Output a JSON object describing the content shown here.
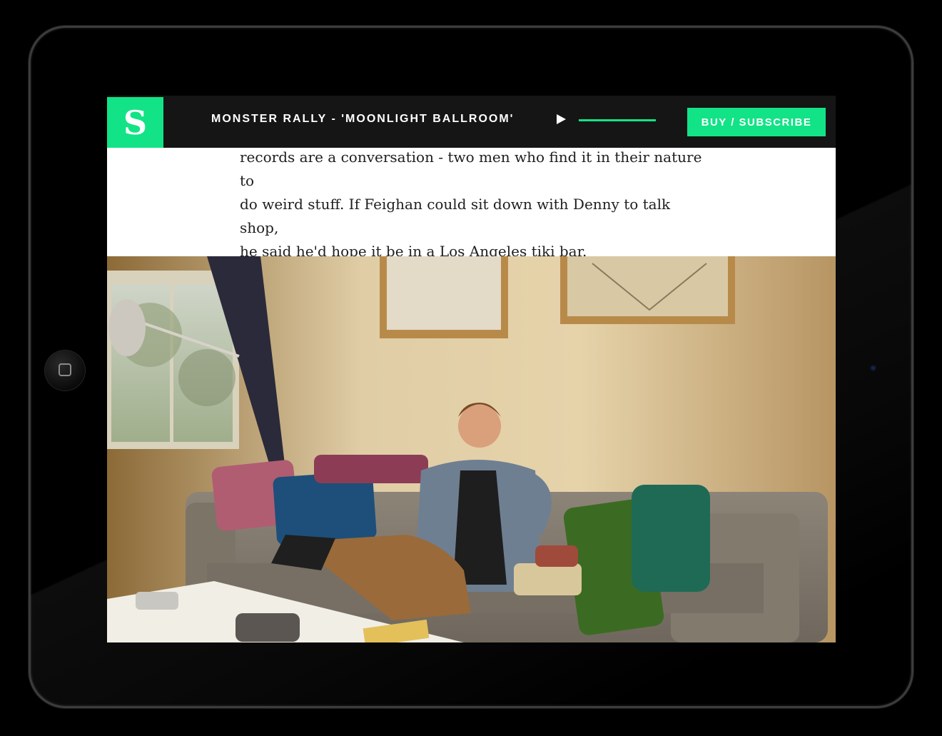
{
  "header": {
    "logo_letter": "S",
    "track_title": "MONSTER RALLY - 'MOONLIGHT BALLROOM'",
    "buy_label": "BUY / SUBSCRIBE",
    "progress": 1.0
  },
  "article": {
    "lines": [
      "records are a conversation - two men who find it in their nature to",
      "do weird stuff. If Feighan could sit down with Denny to talk shop,",
      "he said he'd hope it be in a Los Angeles tiki bar."
    ]
  },
  "icons": {
    "play": "play-icon",
    "home": "home-button-icon",
    "camera": "camera-icon"
  },
  "colors": {
    "accent": "#12e386",
    "header_bg": "#151515",
    "text": "#1e1e1e"
  }
}
